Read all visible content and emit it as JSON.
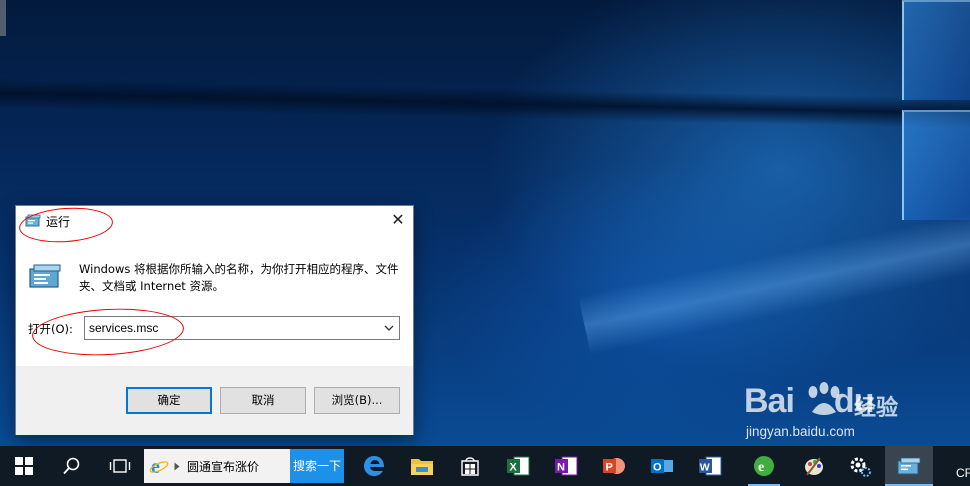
{
  "run_dialog": {
    "title": "运行",
    "close_glyph": "✕",
    "description": "Windows 将根据你所输入的名称，为你打开相应的程序、文件夹、文档或 Internet 资源。",
    "open_label": "打开(O):",
    "open_value": "services.msc",
    "buttons": {
      "ok": "确定",
      "cancel": "取消",
      "browse": "浏览(B)..."
    }
  },
  "watermark": {
    "brand_latin": "Bai",
    "brand_latin2": "du",
    "brand_cn": "经验",
    "url": "jingyan.baidu.com"
  },
  "taskbar": {
    "search_text": "圆通宣布涨价",
    "search_button": "搜索一下",
    "tray_text": "CF",
    "icons": [
      "windows-start-icon",
      "search-icon",
      "task-view-icon",
      "ie-icon",
      "edge-icon",
      "file-explorer-icon",
      "store-icon",
      "excel-icon",
      "onenote-icon",
      "powerpoint-icon",
      "outlook-icon",
      "word-icon",
      "browser-icon",
      "paint-icon",
      "settings-icon",
      "run-icon"
    ],
    "colors": {
      "excel": "#1d6f42",
      "onenote": "#7719aa",
      "powerpoint": "#d24726",
      "outlook": "#0072c6",
      "word": "#2b579a",
      "search_button": "#1e90e8"
    }
  }
}
